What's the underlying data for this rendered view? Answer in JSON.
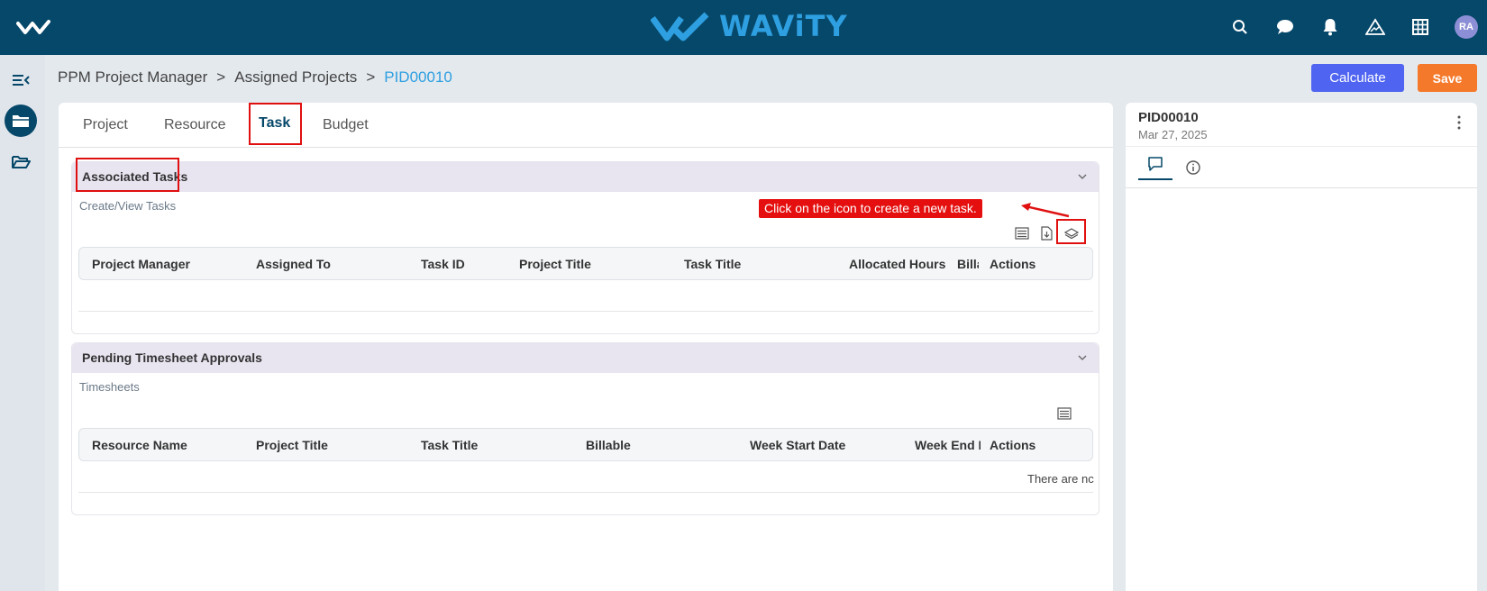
{
  "header": {
    "brand": "WAViTY",
    "avatar_initials": "RA",
    "icons": [
      "search-icon",
      "chat-icon",
      "bell-icon",
      "analytics-icon",
      "grid-icon"
    ]
  },
  "breadcrumb": {
    "items": [
      "PPM Project Manager",
      "Assigned Projects"
    ],
    "separator": ">",
    "current": "PID00010"
  },
  "actions": {
    "calculate_label": "Calculate",
    "save_label": "Save"
  },
  "tabs": [
    {
      "label": "Project"
    },
    {
      "label": "Resource"
    },
    {
      "label": "Task",
      "active": true
    },
    {
      "label": "Budget"
    }
  ],
  "associated_tasks": {
    "title": "Associated Tasks",
    "subtitle": "Create/View Tasks",
    "columns": [
      "Project Manager",
      "Assigned To",
      "Task ID",
      "Project Title",
      "Task Title",
      "Allocated Hours",
      "Billa",
      "Actions"
    ],
    "rows": []
  },
  "callout": {
    "text": "Click on the icon to create a new task."
  },
  "pending_timesheets": {
    "title": "Pending Timesheet Approvals",
    "subtitle": "Timesheets",
    "columns": [
      "Resource Name",
      "Project Title",
      "Task Title",
      "Billable",
      "Week Start Date",
      "Week End D",
      "Actions"
    ],
    "empty_text": "There are nc"
  },
  "side_panel": {
    "title": "PID00010",
    "date": "Mar 27, 2025"
  },
  "colors": {
    "topbar": "#06486a",
    "brand": "#2e9fe0",
    "calculate": "#4f64f0",
    "save": "#f5792a",
    "highlight": "#e01010"
  }
}
